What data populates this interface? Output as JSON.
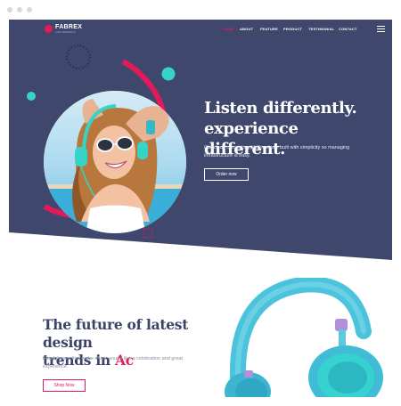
{
  "window": {
    "title": ""
  },
  "nav": {
    "brand": "FABREX",
    "brand_tagline": "LIVE PRODUCTS",
    "items": [
      {
        "label": "HOME",
        "active": true
      },
      {
        "label": "ABOUT",
        "active": false
      },
      {
        "label": "FEATURE",
        "active": false
      },
      {
        "label": "PRODUCT",
        "active": false
      },
      {
        "label": "TESTIMONIAL",
        "active": false
      },
      {
        "label": "CONTACT",
        "active": false
      }
    ],
    "menu_icon": "hamburger-icon"
  },
  "hero": {
    "title_line1": "Listen differently.",
    "title_line2": "experience different.",
    "text": "Our cloud computing platform was built with simplicity so managing infrastructure is easy.",
    "button_label": "Order now"
  },
  "section2": {
    "title_line1": "The future of latest design",
    "title_line2": "trends in ",
    "title_accent": "Ac",
    "text": "Headphones that make music sound like a celebration and great experience.",
    "button_label": "Shop Now"
  },
  "colors": {
    "hero_bg": "#3f486c",
    "accent": "#e4195a",
    "teal": "#35d4c7",
    "title_dark": "#3b4468"
  }
}
